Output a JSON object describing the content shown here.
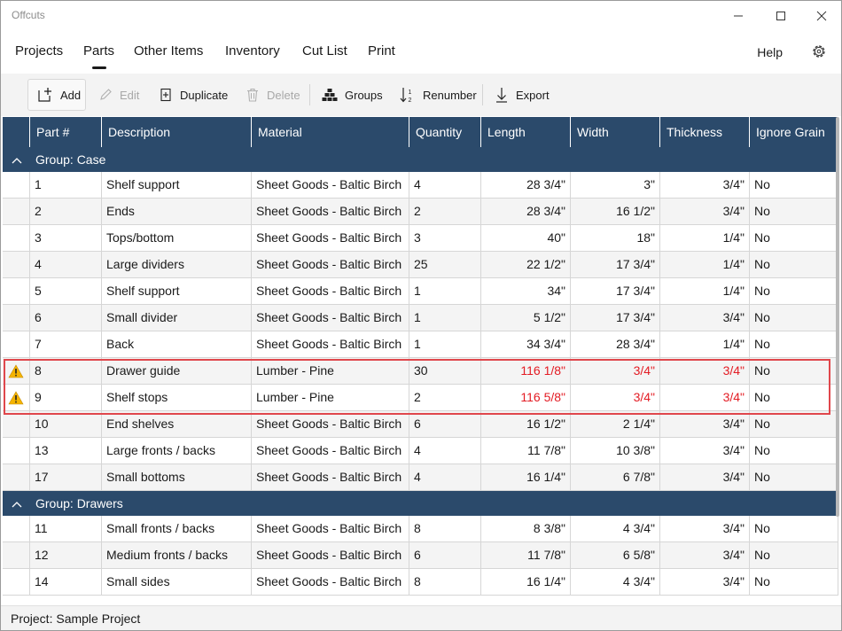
{
  "window": {
    "title": "Offcuts"
  },
  "nav": {
    "tabs": [
      {
        "label": "Projects"
      },
      {
        "label": "Parts"
      },
      {
        "label": "Other Items"
      },
      {
        "label": "Inventory"
      },
      {
        "label": "Cut List"
      },
      {
        "label": "Print"
      }
    ],
    "active_tab": "Parts",
    "help_label": "Help"
  },
  "toolbar": {
    "add": "Add",
    "edit": "Edit",
    "duplicate": "Duplicate",
    "delete": "Delete",
    "groups": "Groups",
    "renumber": "Renumber",
    "export": "Export"
  },
  "table": {
    "columns": [
      "Part #",
      "Description",
      "Material",
      "Quantity",
      "Length",
      "Width",
      "Thickness",
      "Ignore Grain"
    ],
    "groups": [
      {
        "label": "Group:  Case",
        "rows": [
          {
            "part": "1",
            "description": "Shelf support",
            "material": "Sheet Goods - Baltic Birch",
            "quantity": "4",
            "length": "28 3/4\"",
            "width": "3\"",
            "thickness": "3/4\"",
            "ignore_grain": "No"
          },
          {
            "part": "2",
            "description": "Ends",
            "material": "Sheet Goods - Baltic Birch",
            "quantity": "2",
            "length": "28 3/4\"",
            "width": "16 1/2\"",
            "thickness": "3/4\"",
            "ignore_grain": "No"
          },
          {
            "part": "3",
            "description": "Tops/bottom",
            "material": "Sheet Goods - Baltic Birch",
            "quantity": "3",
            "length": "40\"",
            "width": "18\"",
            "thickness": "1/4\"",
            "ignore_grain": "No"
          },
          {
            "part": "4",
            "description": "Large dividers",
            "material": "Sheet Goods - Baltic Birch",
            "quantity": "25",
            "length": "22 1/2\"",
            "width": "17 3/4\"",
            "thickness": "1/4\"",
            "ignore_grain": "No"
          },
          {
            "part": "5",
            "description": "Shelf support",
            "material": "Sheet Goods - Baltic Birch",
            "quantity": "1",
            "length": "34\"",
            "width": "17 3/4\"",
            "thickness": "1/4\"",
            "ignore_grain": "No"
          },
          {
            "part": "6",
            "description": "Small divider",
            "material": "Sheet Goods - Baltic Birch",
            "quantity": "1",
            "length": "5 1/2\"",
            "width": "17 3/4\"",
            "thickness": "3/4\"",
            "ignore_grain": "No"
          },
          {
            "part": "7",
            "description": "Back",
            "material": "Sheet Goods - Baltic Birch",
            "quantity": "1",
            "length": "34 3/4\"",
            "width": "28 3/4\"",
            "thickness": "1/4\"",
            "ignore_grain": "No"
          },
          {
            "part": "8",
            "description": "Drawer guide",
            "material": "Lumber - Pine",
            "quantity": "30",
            "length": "116 1/8\"",
            "width": "3/4\"",
            "thickness": "3/4\"",
            "ignore_grain": "No",
            "warning": true
          },
          {
            "part": "9",
            "description": "Shelf stops",
            "material": "Lumber - Pine",
            "quantity": "2",
            "length": "116 5/8\"",
            "width": "3/4\"",
            "thickness": "3/4\"",
            "ignore_grain": "No",
            "warning": true
          },
          {
            "part": "10",
            "description": "End shelves",
            "material": "Sheet Goods - Baltic Birch",
            "quantity": "6",
            "length": "16 1/2\"",
            "width": "2 1/4\"",
            "thickness": "3/4\"",
            "ignore_grain": "No"
          },
          {
            "part": "13",
            "description": "Large fronts / backs",
            "material": "Sheet Goods - Baltic Birch",
            "quantity": "4",
            "length": "11 7/8\"",
            "width": "10 3/8\"",
            "thickness": "3/4\"",
            "ignore_grain": "No"
          },
          {
            "part": "17",
            "description": "Small bottoms",
            "material": "Sheet Goods - Baltic Birch",
            "quantity": "4",
            "length": "16 1/4\"",
            "width": "6 7/8\"",
            "thickness": "3/4\"",
            "ignore_grain": "No"
          }
        ]
      },
      {
        "label": "Group:  Drawers",
        "rows": [
          {
            "part": "11",
            "description": "Small fronts / backs",
            "material": "Sheet Goods - Baltic Birch",
            "quantity": "8",
            "length": "8 3/8\"",
            "width": "4 3/4\"",
            "thickness": "3/4\"",
            "ignore_grain": "No"
          },
          {
            "part": "12",
            "description": "Medium fronts / backs",
            "material": "Sheet Goods - Baltic Birch",
            "quantity": "6",
            "length": "11 7/8\"",
            "width": "6 5/8\"",
            "thickness": "3/4\"",
            "ignore_grain": "No"
          },
          {
            "part": "14",
            "description": "Small sides",
            "material": "Sheet Goods - Baltic Birch",
            "quantity": "8",
            "length": "16 1/4\"",
            "width": "4 3/4\"",
            "thickness": "3/4\"",
            "ignore_grain": "No"
          }
        ]
      }
    ]
  },
  "status_bar": {
    "project": "Project: Sample Project"
  },
  "colors": {
    "header": "#2b4a6b",
    "error_text": "#e31b23",
    "highlight_border": "#e0474c",
    "warning_icon": "#f5b400"
  }
}
